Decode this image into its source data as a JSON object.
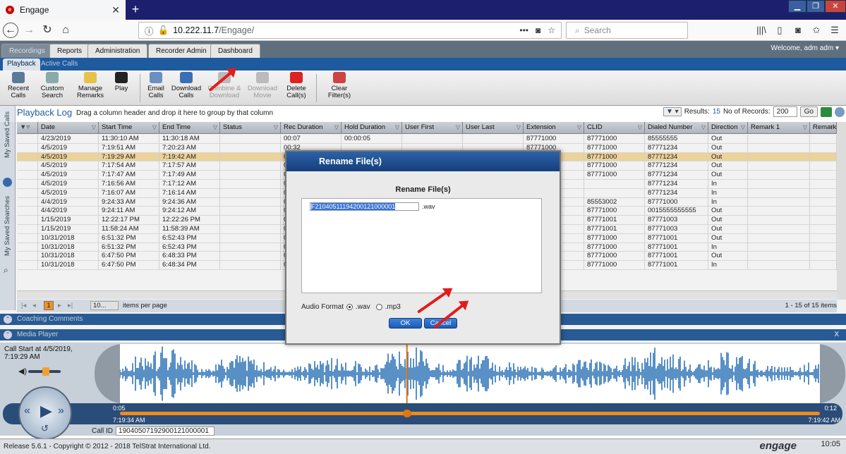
{
  "browser": {
    "tab_title": "Engage",
    "url_host": "10.222.11.7",
    "url_path": "/Engage/",
    "search_placeholder": "Search",
    "more": "•••"
  },
  "app": {
    "main_tabs": [
      "Recordings",
      "Reports",
      "Administration",
      "Recorder Admin",
      "Dashboard"
    ],
    "welcome": "Welcome,  adm adm  ▾",
    "sub_tabs": [
      "Playback",
      "Active Calls"
    ],
    "toolbar": [
      {
        "label": "Recent\nCalls",
        "color": "#5a7a9a",
        "enabled": true
      },
      {
        "label": "Custom\nSearch",
        "color": "#8aa",
        "enabled": true
      },
      {
        "label": "Manage\nRemarks",
        "color": "#e5c24a",
        "enabled": true
      },
      {
        "label": "Play",
        "color": "#222",
        "enabled": true
      },
      {
        "label": "Email\nCalls",
        "color": "#6b8fc2",
        "enabled": true
      },
      {
        "label": "Download\nCalls",
        "color": "#3b6fb5",
        "enabled": true
      },
      {
        "label": "Combine &\nDownload",
        "color": "#bbb",
        "enabled": false
      },
      {
        "label": "Download\nMovie",
        "color": "#bbb",
        "enabled": false
      },
      {
        "label": "Delete\nCall(s)",
        "color": "#d22",
        "enabled": true
      },
      {
        "label": "Clear\nFilter(s)",
        "color": "#c44",
        "enabled": true
      }
    ],
    "side": {
      "saved_calls": "My Saved Calls",
      "saved_searches": "My Saved Searches"
    }
  },
  "grid": {
    "title": "Playback Log",
    "hint": "Drag a column header and drop it here to group by that column",
    "results_label": "Results:",
    "results": "15",
    "records_label": "No of Records:",
    "records": "200",
    "go": "Go",
    "columns": [
      "Date",
      "Start Time",
      "End Time",
      "Status",
      "Rec Duration",
      "Hold Duration",
      "User First",
      "User Last",
      "Extension",
      "CLID",
      "Dialed Number",
      "Direction",
      "Remark 1",
      "Remark"
    ],
    "rows": [
      [
        "4/23/2019",
        "11:30:10 AM",
        "11:30:18 AM",
        "",
        "00:07",
        "00:00:05",
        "",
        "",
        "87771000",
        "87771000",
        "85555555",
        "Out",
        "",
        ""
      ],
      [
        "4/5/2019",
        "7:19:51 AM",
        "7:20:23 AM",
        "",
        "00:32",
        "",
        "",
        "",
        "87771000",
        "87771000",
        "87771234",
        "Out",
        "",
        ""
      ],
      [
        "4/5/2019",
        "7:19:29 AM",
        "7:19:42 AM",
        "",
        "0",
        "",
        "",
        "",
        "",
        "87771000",
        "87771234",
        "Out",
        "",
        ""
      ],
      [
        "4/5/2019",
        "7:17:54 AM",
        "7:17:57 AM",
        "",
        "0",
        "",
        "",
        "",
        "",
        "87771000",
        "87771234",
        "Out",
        "",
        ""
      ],
      [
        "4/5/2019",
        "7:17:47 AM",
        "7:17:49 AM",
        "",
        "0",
        "",
        "",
        "",
        "",
        "87771000",
        "87771234",
        "Out",
        "",
        ""
      ],
      [
        "4/5/2019",
        "7:16:56 AM",
        "7:17:12 AM",
        "",
        "0",
        "",
        "",
        "",
        "",
        "",
        "87771234",
        "In",
        "",
        ""
      ],
      [
        "4/5/2019",
        "7:16:07 AM",
        "7:16:14 AM",
        "",
        "0",
        "",
        "",
        "",
        "",
        "",
        "87771234",
        "In",
        "",
        ""
      ],
      [
        "4/4/2019",
        "9:24:33 AM",
        "9:24:36 AM",
        "",
        "0",
        "",
        "",
        "",
        "",
        "85553002",
        "87771000",
        "In",
        "",
        ""
      ],
      [
        "4/4/2019",
        "9:24:11 AM",
        "9:24:12 AM",
        "",
        "0",
        "",
        "",
        "",
        "",
        "87771000",
        "0015555555555",
        "Out",
        "",
        ""
      ],
      [
        "1/15/2019",
        "12:22:17 PM",
        "12:22:26 PM",
        "",
        "0",
        "",
        "",
        "",
        "",
        "87771001",
        "87771003",
        "Out",
        "",
        ""
      ],
      [
        "1/15/2019",
        "11:58:24 AM",
        "11:58:39 AM",
        "",
        "0",
        "",
        "",
        "",
        "",
        "87771001",
        "87771003",
        "Out",
        "",
        ""
      ],
      [
        "10/31/2018",
        "6:51:32 PM",
        "6:52:43 PM",
        "",
        "0",
        "",
        "",
        "",
        "",
        "87771000",
        "87771001",
        "Out",
        "",
        ""
      ],
      [
        "10/31/2018",
        "6:51:32 PM",
        "6:52:43 PM",
        "",
        "0",
        "",
        "",
        "",
        "",
        "87771000",
        "87771001",
        "In",
        "",
        ""
      ],
      [
        "10/31/2018",
        "6:47:50 PM",
        "6:48:33 PM",
        "",
        "0",
        "",
        "",
        "",
        "",
        "87771000",
        "87771001",
        "Out",
        "",
        ""
      ],
      [
        "10/31/2018",
        "6:47:50 PM",
        "6:48:34 PM",
        "",
        "0",
        "",
        "",
        "",
        "",
        "87771000",
        "87771001",
        "In",
        "",
        ""
      ]
    ],
    "selected_row": 2,
    "page": "1",
    "page_size": "10...",
    "items_per_page": "items per page",
    "range": "1 - 15 of 15 items"
  },
  "panels": {
    "coaching": "Coaching Comments",
    "media": "Media Player"
  },
  "media": {
    "call_start": "Call Start at 4/5/2019,\n7:19:29 AM",
    "pos_left": "0:05",
    "pos_right": "0:12",
    "time_left": "7:19:34 AM",
    "time_right": "7:19:42 AM",
    "callid_label": "Call ID",
    "callid": "19040507192900121000001",
    "close": "X",
    "playhead": 0.41
  },
  "dialog": {
    "title": "Rename File(s)",
    "heading": "Rename File(s)",
    "filename": "F21040511194200121000001",
    "ext": ".wav",
    "audio_format_label": "Audio Format",
    "format_options": [
      ".wav",
      ".mp3"
    ],
    "selected_format": ".wav",
    "ok": "OK",
    "cancel": "Cancel"
  },
  "footer": {
    "release": "Release 5.6.1 - Copyright © 2012 - 2018 TelStrat International Ltd.",
    "brand": "engage",
    "clock": "10:05"
  }
}
